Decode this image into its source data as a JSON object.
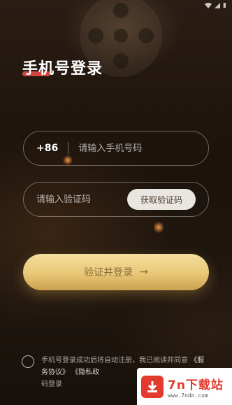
{
  "status_bar": {
    "time": "",
    "battery": "▮"
  },
  "login": {
    "title": "手机号登录",
    "phone_prefix": "+86",
    "phone_placeholder": "请输入手机号码",
    "code_placeholder": "请输入验证码",
    "get_code_label": "获取验证码",
    "submit_label": "验证并登录",
    "submit_arrow": "→"
  },
  "agreement": {
    "text_prefix": "手机号登录成功后将自动注册，我已阅读并同意",
    "link_service": "《服务协议》",
    "link_privacy": "《隐私政",
    "text_suffix": "码登录"
  },
  "watermark": {
    "title": "7n下载站",
    "url": "www.7ndn.com"
  },
  "colors": {
    "accent_red": "#d0453f",
    "gold_button": "#e9c777",
    "background": "#1c130c"
  }
}
